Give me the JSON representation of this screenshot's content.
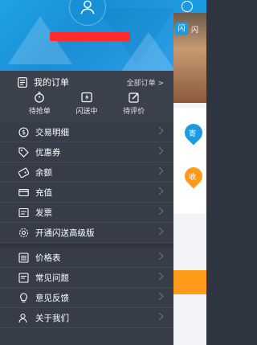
{
  "profile": {
    "avatar_icon": "user-icon",
    "username": "",
    "accent": "#1fa3e6"
  },
  "orders": {
    "title": "我的订单",
    "all_link": "全部订单 >",
    "tabs": [
      {
        "label": "待抢单",
        "icon": "stopwatch-icon"
      },
      {
        "label": "闪送中",
        "icon": "lightning-box-icon"
      },
      {
        "label": "待评价",
        "icon": "edit-icon"
      }
    ]
  },
  "menu": {
    "group1": [
      {
        "label": "交易明细",
        "icon": "dollar-circle-icon"
      },
      {
        "label": "优惠券",
        "icon": "tag-icon"
      },
      {
        "label": "余额",
        "icon": "wallet-icon"
      },
      {
        "label": "充值",
        "icon": "card-icon"
      },
      {
        "label": "发票",
        "icon": "invoice-icon"
      },
      {
        "label": "开通闪送高级版",
        "icon": "gear-icon"
      }
    ],
    "group2": [
      {
        "label": "价格表",
        "icon": "list-icon"
      },
      {
        "label": "常见问题",
        "icon": "question-doc-icon"
      },
      {
        "label": "意见反馈",
        "icon": "lightbulb-icon"
      },
      {
        "label": "关于我们",
        "icon": "person-icon"
      }
    ]
  },
  "peek": {
    "logo_glyph": "闪",
    "logo_text": "闪",
    "pin_blue_label": "寄",
    "pin_orange_label": "收",
    "blue": "#1e9ae0",
    "orange": "#ff9a1a"
  }
}
